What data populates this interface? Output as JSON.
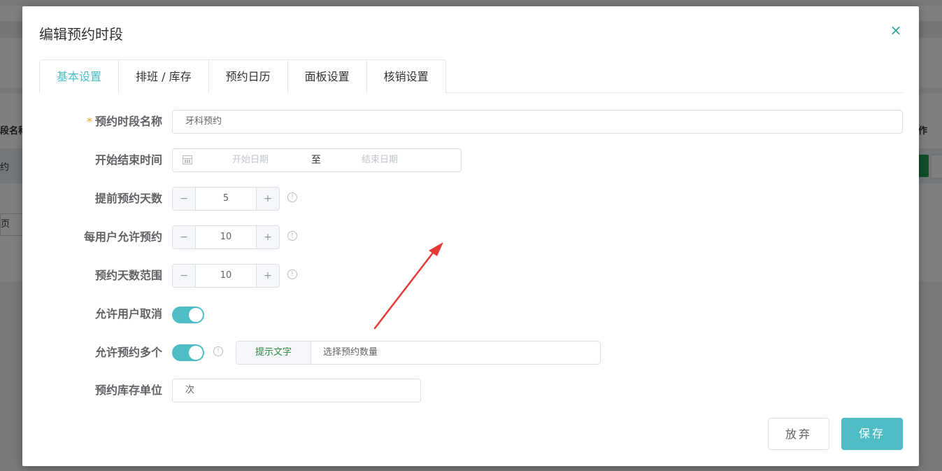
{
  "background": {
    "table_header_left": "段名称",
    "table_header_right": "作",
    "table_row_left": "约",
    "pager_label": "页"
  },
  "modal": {
    "title": "编辑预约时段",
    "close_symbol": "×"
  },
  "tabs": [
    {
      "label": "基本设置",
      "active": true
    },
    {
      "label": "排班 / 库存",
      "active": false
    },
    {
      "label": "预约日历",
      "active": false
    },
    {
      "label": "面板设置",
      "active": false
    },
    {
      "label": "核销设置",
      "active": false
    }
  ],
  "form": {
    "name": {
      "required_mark": "*",
      "label": "预约时段名称",
      "value": "牙科预约"
    },
    "time_range": {
      "label": "开始结束时间",
      "start_placeholder": "开始日期",
      "separator": "至",
      "end_placeholder": "结束日期"
    },
    "advance_days": {
      "label": "提前预约天数",
      "value": "5"
    },
    "per_user": {
      "label": "每用户允许预约",
      "value": "10"
    },
    "day_range": {
      "label": "预约天数范围",
      "value": "10"
    },
    "allow_cancel": {
      "label": "允许用户取消",
      "enabled": true
    },
    "allow_multiple": {
      "label": "允许预约多个",
      "enabled": true,
      "hint_prefix": "提示文字",
      "hint_value": "选择预约数量"
    },
    "unit": {
      "label": "预约库存单位",
      "value": "次"
    }
  },
  "stepper_symbols": {
    "minus": "−",
    "plus": "+"
  },
  "info_symbol": "!",
  "buttons": {
    "cancel": "放弃",
    "save": "保存"
  },
  "colors": {
    "accent": "#4fbdc5",
    "annotation_arrow": "#e53935",
    "required_mark": "#f5a623"
  }
}
